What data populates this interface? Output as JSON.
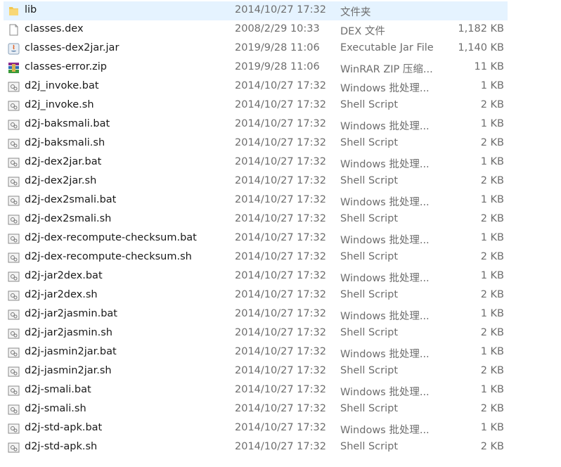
{
  "files": [
    {
      "name": "lib",
      "date": "2014/10/27 17:32",
      "type": "文件夹",
      "size": "",
      "icon": "folder-icon",
      "selected": true
    },
    {
      "name": "classes.dex",
      "date": "2008/2/29 10:33",
      "type": "DEX 文件",
      "size": "1,182 KB",
      "icon": "file-icon"
    },
    {
      "name": "classes-dex2jar.jar",
      "date": "2019/9/28 11:06",
      "type": "Executable Jar File",
      "size": "1,140 KB",
      "icon": "java-icon"
    },
    {
      "name": "classes-error.zip",
      "date": "2019/9/28 11:06",
      "type": "WinRAR ZIP 压缩...",
      "size": "11 KB",
      "icon": "winrar-icon"
    },
    {
      "name": "d2j_invoke.bat",
      "date": "2014/10/27 17:32",
      "type": "Windows 批处理...",
      "size": "1 KB",
      "icon": "script-icon"
    },
    {
      "name": "d2j_invoke.sh",
      "date": "2014/10/27 17:32",
      "type": "Shell Script",
      "size": "2 KB",
      "icon": "script-icon"
    },
    {
      "name": "d2j-baksmali.bat",
      "date": "2014/10/27 17:32",
      "type": "Windows 批处理...",
      "size": "1 KB",
      "icon": "script-icon"
    },
    {
      "name": "d2j-baksmali.sh",
      "date": "2014/10/27 17:32",
      "type": "Shell Script",
      "size": "2 KB",
      "icon": "script-icon"
    },
    {
      "name": "d2j-dex2jar.bat",
      "date": "2014/10/27 17:32",
      "type": "Windows 批处理...",
      "size": "1 KB",
      "icon": "script-icon"
    },
    {
      "name": "d2j-dex2jar.sh",
      "date": "2014/10/27 17:32",
      "type": "Shell Script",
      "size": "2 KB",
      "icon": "script-icon"
    },
    {
      "name": "d2j-dex2smali.bat",
      "date": "2014/10/27 17:32",
      "type": "Windows 批处理...",
      "size": "1 KB",
      "icon": "script-icon"
    },
    {
      "name": "d2j-dex2smali.sh",
      "date": "2014/10/27 17:32",
      "type": "Shell Script",
      "size": "2 KB",
      "icon": "script-icon"
    },
    {
      "name": "d2j-dex-recompute-checksum.bat",
      "date": "2014/10/27 17:32",
      "type": "Windows 批处理...",
      "size": "1 KB",
      "icon": "script-icon"
    },
    {
      "name": "d2j-dex-recompute-checksum.sh",
      "date": "2014/10/27 17:32",
      "type": "Shell Script",
      "size": "2 KB",
      "icon": "script-icon"
    },
    {
      "name": "d2j-jar2dex.bat",
      "date": "2014/10/27 17:32",
      "type": "Windows 批处理...",
      "size": "1 KB",
      "icon": "script-icon"
    },
    {
      "name": "d2j-jar2dex.sh",
      "date": "2014/10/27 17:32",
      "type": "Shell Script",
      "size": "2 KB",
      "icon": "script-icon"
    },
    {
      "name": "d2j-jar2jasmin.bat",
      "date": "2014/10/27 17:32",
      "type": "Windows 批处理...",
      "size": "1 KB",
      "icon": "script-icon"
    },
    {
      "name": "d2j-jar2jasmin.sh",
      "date": "2014/10/27 17:32",
      "type": "Shell Script",
      "size": "2 KB",
      "icon": "script-icon"
    },
    {
      "name": "d2j-jasmin2jar.bat",
      "date": "2014/10/27 17:32",
      "type": "Windows 批处理...",
      "size": "1 KB",
      "icon": "script-icon"
    },
    {
      "name": "d2j-jasmin2jar.sh",
      "date": "2014/10/27 17:32",
      "type": "Shell Script",
      "size": "2 KB",
      "icon": "script-icon"
    },
    {
      "name": "d2j-smali.bat",
      "date": "2014/10/27 17:32",
      "type": "Windows 批处理...",
      "size": "1 KB",
      "icon": "script-icon"
    },
    {
      "name": "d2j-smali.sh",
      "date": "2014/10/27 17:32",
      "type": "Shell Script",
      "size": "2 KB",
      "icon": "script-icon"
    },
    {
      "name": "d2j-std-apk.bat",
      "date": "2014/10/27 17:32",
      "type": "Windows 批处理...",
      "size": "1 KB",
      "icon": "script-icon"
    },
    {
      "name": "d2j-std-apk.sh",
      "date": "2014/10/27 17:32",
      "type": "Shell Script",
      "size": "2 KB",
      "icon": "script-icon"
    }
  ],
  "colors": {
    "selection": "#e5f3ff",
    "secondary_text": "#6d6d6d"
  }
}
